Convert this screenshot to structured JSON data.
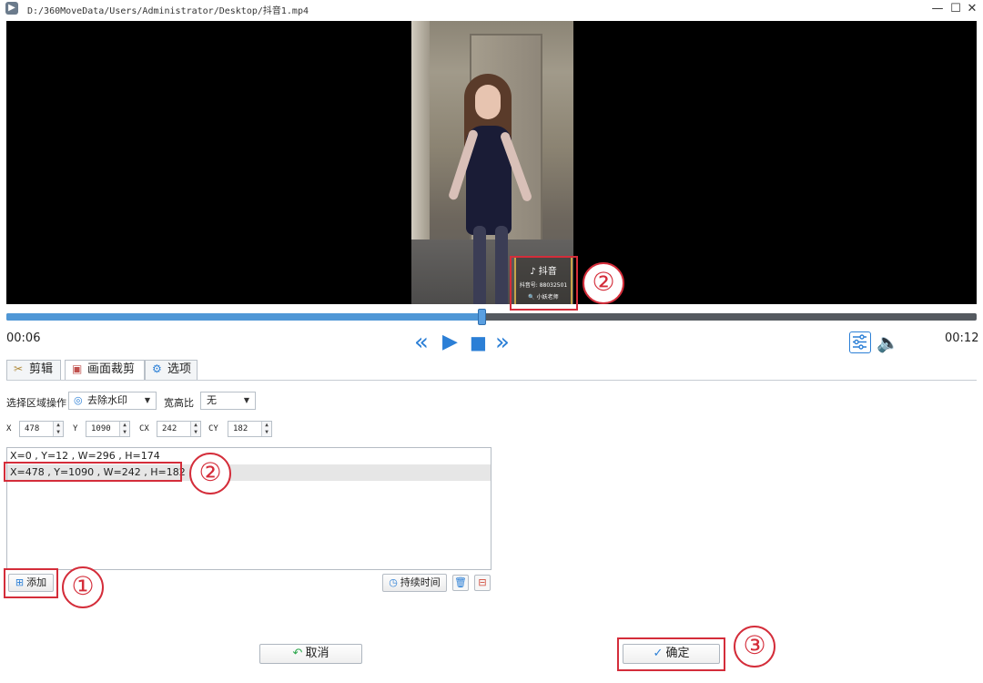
{
  "window": {
    "title_path": "D:/360MoveData/Users/Administrator/Desktop/抖音1.mp4",
    "min_glyph": "—",
    "max_glyph": "☐",
    "close_glyph": "✕"
  },
  "video": {
    "watermark": {
      "brand": "♪ 抖音",
      "account": "抖音号: 88032501",
      "name": "🔍 小妖老师"
    },
    "progress_fraction": 0.49
  },
  "player": {
    "current_time": "00:06",
    "total_time": "00:12",
    "rewind_icon": "«",
    "play_icon": "▶",
    "stop_icon": "■",
    "forward_icon": "»",
    "settings_icon": "sliders-icon",
    "volume_icon": "🔈"
  },
  "tabs": [
    {
      "label": "剪辑",
      "icon": "✂"
    },
    {
      "label": "画面裁剪",
      "icon": "▣"
    },
    {
      "label": "选项",
      "icon": "⚙"
    }
  ],
  "crop": {
    "region_op_label": "选择区域操作",
    "region_op_value": "去除水印",
    "ratio_label": "宽高比",
    "ratio_value": "无",
    "x_label": "X",
    "x_value": "478",
    "y_label": "Y",
    "y_value": "1090",
    "cx_label": "CX",
    "cx_value": "242",
    "cy_label": "CY",
    "cy_value": "182",
    "regions": [
      "X=0 , Y=12 , W=296 , H=174",
      "X=478 , Y=1090 , W=242 , H=182"
    ],
    "add_label": "添加",
    "duration_label": "持续时间"
  },
  "footer": {
    "cancel_label": "取消",
    "ok_label": "确定"
  },
  "annotations": {
    "step1": "①",
    "step2": "②",
    "step3": "③"
  },
  "colors": {
    "accent": "#2b7fd6",
    "annotation_red": "#d42d3a",
    "progress_fill": "#4f97d6"
  }
}
